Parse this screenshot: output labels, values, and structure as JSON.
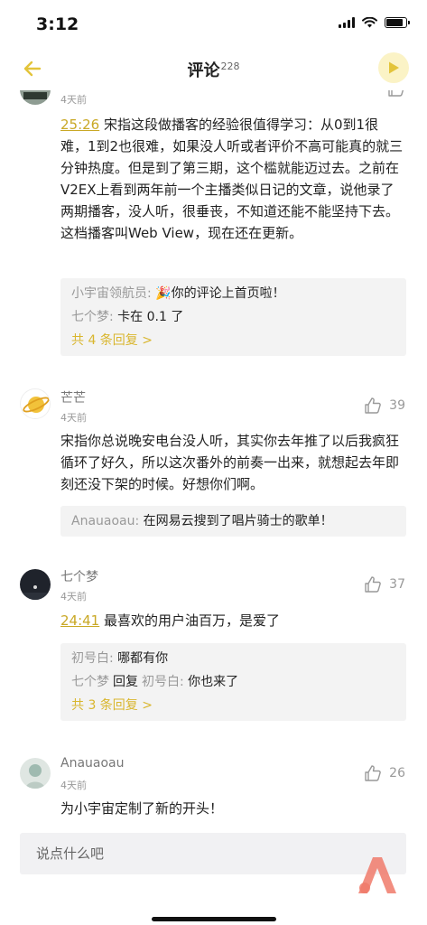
{
  "status": {
    "time": "3:12"
  },
  "nav": {
    "title": "评论",
    "count": "228"
  },
  "comments": [
    {
      "author": "",
      "time": "4天前",
      "likes": "",
      "timestamp": "25:26",
      "text": "宋指这段做播客的经验很值得学习：从0到1很难，1到2也很难，如果没人听或者评价不高可能真的就三分钟热度。但是到了第三期，这个槛就能迈过去。之前在V2EX上看到两年前一个主播类似日记的文章，说他录了两期播客，没人听，很垂丧，不知道还能不能坚持下去。这档播客叫Web View，现在还在更新。",
      "replies": [
        {
          "name": "小宇宙领航员",
          "text": "你的评论上首页啦！"
        },
        {
          "name": "七个梦",
          "text": "卡在 0.1 了"
        }
      ],
      "more": "共 4 条回复 >"
    },
    {
      "author": "芒芒",
      "time": "4天前",
      "likes": "39",
      "text": "宋指你总说晚安电台没人听，其实你去年推了以后我疯狂循环了好久，所以这次番外的前奏一出来，就想起去年即刻还没下架的时候。好想你们啊。",
      "replies": [
        {
          "name": "Anauaoau",
          "text": "在网易云搜到了唱片骑士的歌单！"
        }
      ]
    },
    {
      "author": "七个梦",
      "time": "4天前",
      "likes": "37",
      "timestamp": "24:41",
      "text": "最喜欢的用户油百万，是爱了",
      "replies": [
        {
          "name": "初号白",
          "text": "哪都有你"
        },
        {
          "name": "七个梦",
          "verb": "回复",
          "target": "初号白",
          "text": "你也来了"
        }
      ],
      "more": "共 3 条回复 >"
    },
    {
      "author": "Anauaoau",
      "time": "4天前",
      "likes": "26",
      "text": "为小宇宙定制了新的开头！"
    }
  ],
  "input": {
    "placeholder": "说点什么吧"
  },
  "colors": {
    "accent": "#e3c43a",
    "link": "#d9b62e",
    "reply_bg": "#f3f3f3"
  }
}
